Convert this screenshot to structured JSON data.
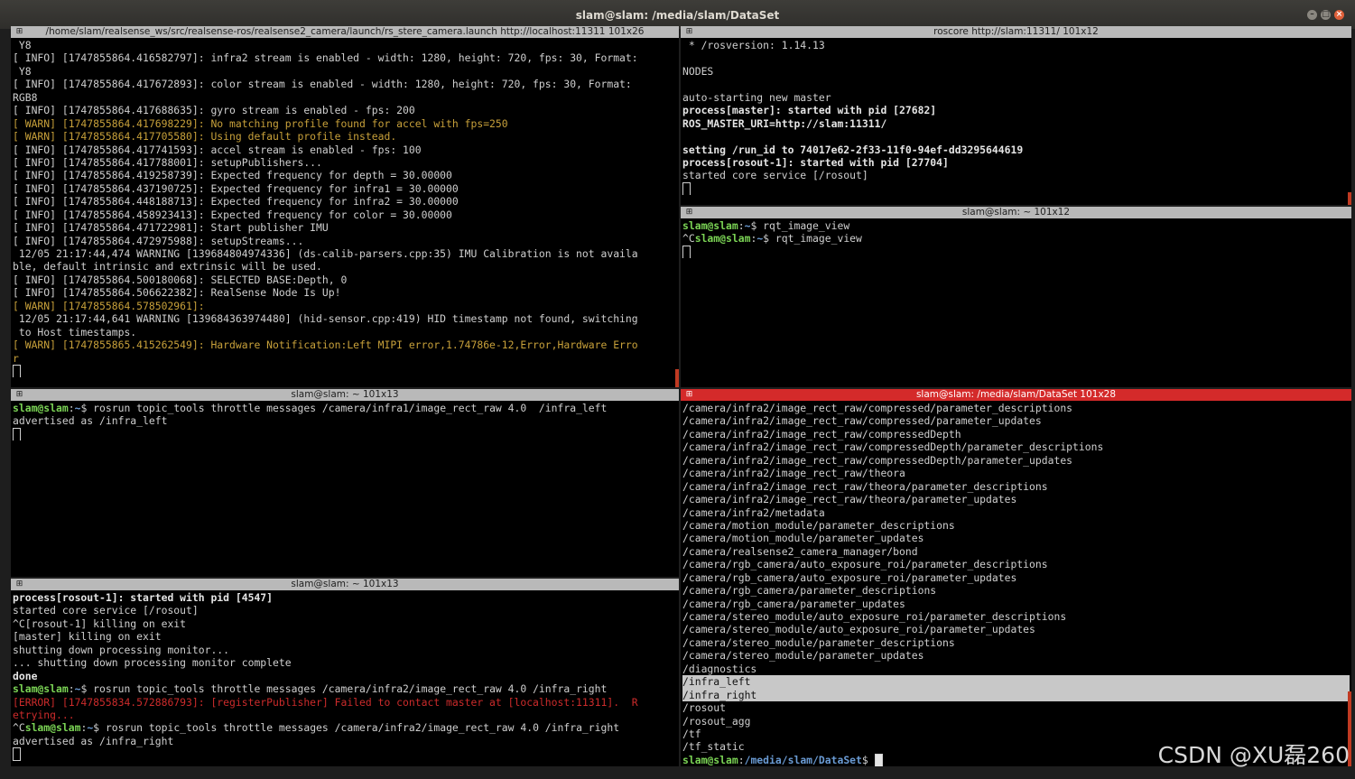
{
  "window": {
    "title": "slam@slam: /media/slam/DataSet"
  },
  "panes": {
    "tl": {
      "title": "/home/slam/realsense_ws/src/realsense-ros/realsense2_camera/launch/rs_stere_camera.launch http://localhost:11311 101x26",
      "lines": [
        {
          "t": " Y8",
          "c": ""
        },
        {
          "t": "[ INFO] [1747855864.416582797]: infra2 stream is enabled - width: 1280, height: 720, fps: 30, Format:",
          "c": ""
        },
        {
          "t": " Y8",
          "c": ""
        },
        {
          "t": "[ INFO] [1747855864.417672893]: color stream is enabled - width: 1280, height: 720, fps: 30, Format:",
          "c": ""
        },
        {
          "t": "RGB8",
          "c": ""
        },
        {
          "t": "[ INFO] [1747855864.417688635]: gyro stream is enabled - fps: 200",
          "c": ""
        },
        {
          "t": "[ WARN] [1747855864.417698229]: No matching profile found for accel with fps=250",
          "c": "warn"
        },
        {
          "t": "[ WARN] [1747855864.417705580]: Using default profile instead.",
          "c": "warn"
        },
        {
          "t": "[ INFO] [1747855864.417741593]: accel stream is enabled - fps: 100",
          "c": ""
        },
        {
          "t": "[ INFO] [1747855864.417788001]: setupPublishers...",
          "c": ""
        },
        {
          "t": "[ INFO] [1747855864.419258739]: Expected frequency for depth = 30.00000",
          "c": ""
        },
        {
          "t": "[ INFO] [1747855864.437190725]: Expected frequency for infra1 = 30.00000",
          "c": ""
        },
        {
          "t": "[ INFO] [1747855864.448188713]: Expected frequency for infra2 = 30.00000",
          "c": ""
        },
        {
          "t": "[ INFO] [1747855864.458923413]: Expected frequency for color = 30.00000",
          "c": ""
        },
        {
          "t": "[ INFO] [1747855864.471722981]: Start publisher IMU",
          "c": ""
        },
        {
          "t": "[ INFO] [1747855864.472975988]: setupStreams...",
          "c": ""
        },
        {
          "t": " 12/05 21:17:44,474 WARNING [139684804974336] (ds-calib-parsers.cpp:35) IMU Calibration is not availa",
          "c": ""
        },
        {
          "t": "ble, default intrinsic and extrinsic will be used.",
          "c": ""
        },
        {
          "t": "[ INFO] [1747855864.500180068]: SELECTED BASE:Depth, 0",
          "c": ""
        },
        {
          "t": "[ INFO] [1747855864.506622382]: RealSense Node Is Up!",
          "c": ""
        },
        {
          "t": "[ WARN] [1747855864.578502961]:",
          "c": "warn"
        },
        {
          "t": " 12/05 21:17:44,641 WARNING [139684363974480] (hid-sensor.cpp:419) HID timestamp not found, switching",
          "c": ""
        },
        {
          "t": " to Host timestamps.",
          "c": ""
        },
        {
          "t": "[ WARN] [1747855865.415262549]: Hardware Notification:Left MIPI error,1.74786e-12,Error,Hardware Erro",
          "c": "warn"
        },
        {
          "t": "r",
          "c": "warn"
        }
      ]
    },
    "tr": {
      "title": "roscore http://slam:11311/ 101x12",
      "lines": [
        {
          "t": " * /rosversion: 1.14.13",
          "c": ""
        },
        {
          "t": "",
          "c": ""
        },
        {
          "t": "NODES",
          "c": ""
        },
        {
          "t": "",
          "c": ""
        },
        {
          "t": "auto-starting new master",
          "c": ""
        },
        {
          "t": "process[master]: started with pid [27682]",
          "c": "bold"
        },
        {
          "t": "ROS_MASTER_URI=http://slam:11311/",
          "c": "bold"
        },
        {
          "t": "",
          "c": ""
        },
        {
          "t": "setting /run_id to 74017e62-2f33-11f0-94ef-dd3295644619",
          "c": "bold"
        },
        {
          "t": "process[rosout-1]: started with pid [27704]",
          "c": "bold"
        },
        {
          "t": "started core service [/rosout]",
          "c": ""
        }
      ]
    },
    "mr": {
      "title": "slam@slam: ~ 101x12",
      "prompt": "slam@slam",
      "path": "~",
      "line1_cmd": "$ rqt_image_view",
      "line2_prefix": "^C",
      "line2_cmd": "$ rqt_image_view"
    },
    "ml": {
      "title": "slam@slam: ~ 101x13",
      "prompt": "slam@slam",
      "path": "~",
      "cmd": "$ rosrun topic_tools throttle messages /camera/infra1/image_rect_raw 4.0  /infra_left",
      "out": "advertised as /infra_left"
    },
    "bl": {
      "title": "slam@slam: ~ 101x13",
      "prompt": "slam@slam",
      "path": "~",
      "lines": [
        {
          "t": "process[rosout-1]: started with pid [4547]",
          "c": "bold"
        },
        {
          "t": "started core service [/rosout]",
          "c": ""
        },
        {
          "t": "^C[rosout-1] killing on exit",
          "c": ""
        },
        {
          "t": "[master] killing on exit",
          "c": ""
        },
        {
          "t": "shutting down processing monitor...",
          "c": ""
        },
        {
          "t": "... shutting down processing monitor complete",
          "c": ""
        },
        {
          "t": "done",
          "c": "bold"
        }
      ],
      "cmd1": "$ rosrun topic_tools throttle messages /camera/infra2/image_rect_raw 4.0 /infra_right",
      "err1": "[ERROR] [1747855834.572886793]: [registerPublisher] Failed to contact master at [localhost:11311].  R",
      "err2": "etrying...",
      "ctrl_c": "^C",
      "cmd2": "$ rosrun topic_tools throttle messages /camera/infra2/image_rect_raw 4.0 /infra_right",
      "out": "advertised as /infra_right"
    },
    "br": {
      "title": "slam@slam: /media/slam/DataSet 101x28",
      "prompt": "slam@slam",
      "path": "/media/slam/DataSet",
      "prompt_suffix": "$ ",
      "lines": [
        {
          "t": "/camera/infra2/image_rect_raw/compressed/parameter_descriptions",
          "c": ""
        },
        {
          "t": "/camera/infra2/image_rect_raw/compressed/parameter_updates",
          "c": ""
        },
        {
          "t": "/camera/infra2/image_rect_raw/compressedDepth",
          "c": ""
        },
        {
          "t": "/camera/infra2/image_rect_raw/compressedDepth/parameter_descriptions",
          "c": ""
        },
        {
          "t": "/camera/infra2/image_rect_raw/compressedDepth/parameter_updates",
          "c": ""
        },
        {
          "t": "/camera/infra2/image_rect_raw/theora",
          "c": ""
        },
        {
          "t": "/camera/infra2/image_rect_raw/theora/parameter_descriptions",
          "c": ""
        },
        {
          "t": "/camera/infra2/image_rect_raw/theora/parameter_updates",
          "c": ""
        },
        {
          "t": "/camera/infra2/metadata",
          "c": ""
        },
        {
          "t": "/camera/motion_module/parameter_descriptions",
          "c": ""
        },
        {
          "t": "/camera/motion_module/parameter_updates",
          "c": ""
        },
        {
          "t": "/camera/realsense2_camera_manager/bond",
          "c": ""
        },
        {
          "t": "/camera/rgb_camera/auto_exposure_roi/parameter_descriptions",
          "c": ""
        },
        {
          "t": "/camera/rgb_camera/auto_exposure_roi/parameter_updates",
          "c": ""
        },
        {
          "t": "/camera/rgb_camera/parameter_descriptions",
          "c": ""
        },
        {
          "t": "/camera/rgb_camera/parameter_updates",
          "c": ""
        },
        {
          "t": "/camera/stereo_module/auto_exposure_roi/parameter_descriptions",
          "c": ""
        },
        {
          "t": "/camera/stereo_module/auto_exposure_roi/parameter_updates",
          "c": ""
        },
        {
          "t": "/camera/stereo_module/parameter_descriptions",
          "c": ""
        },
        {
          "t": "/camera/stereo_module/parameter_updates",
          "c": ""
        },
        {
          "t": "/diagnostics",
          "c": ""
        },
        {
          "t": "/infra_left",
          "c": "hl"
        },
        {
          "t": "/infra_right",
          "c": "hl"
        },
        {
          "t": "/rosout",
          "c": ""
        },
        {
          "t": "/rosout_agg",
          "c": ""
        },
        {
          "t": "/tf",
          "c": ""
        },
        {
          "t": "/tf_static",
          "c": ""
        }
      ]
    }
  },
  "watermark": "CSDN @XU磊260"
}
